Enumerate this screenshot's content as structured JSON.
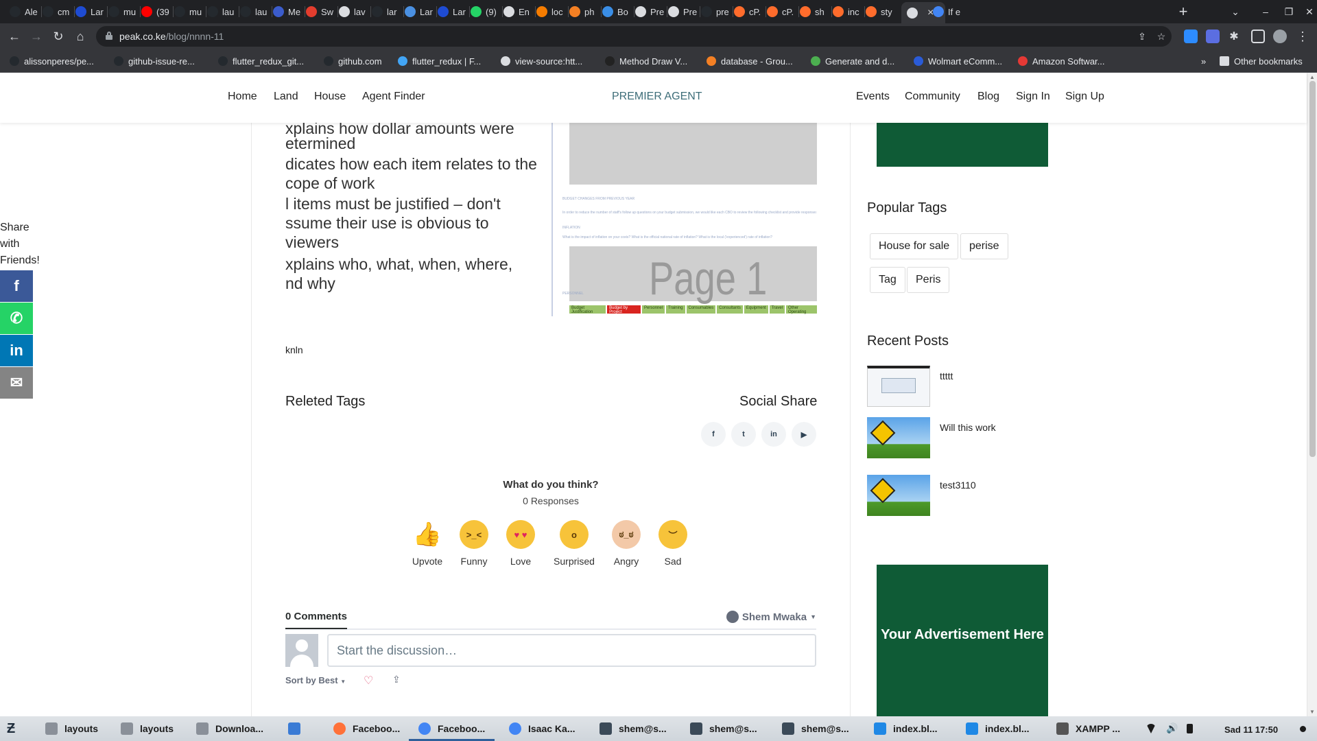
{
  "browser": {
    "tabs": [
      {
        "label": "Ale",
        "icon": "github-icon",
        "color": "#24292e"
      },
      {
        "label": "cm",
        "icon": "github-icon",
        "color": "#24292e"
      },
      {
        "label": "Lar",
        "icon": "tc-icon",
        "color": "#1e4bd2"
      },
      {
        "label": "mu",
        "icon": "github-icon",
        "color": "#24292e"
      },
      {
        "label": "(39",
        "icon": "youtube-icon",
        "color": "#ff0000"
      },
      {
        "label": "mu",
        "icon": "github-icon",
        "color": "#24292e"
      },
      {
        "label": "lau",
        "icon": "github-icon",
        "color": "#24292e"
      },
      {
        "label": "lau",
        "icon": "github-icon",
        "color": "#24292e"
      },
      {
        "label": "Me",
        "icon": "m-icon",
        "color": "#3b5ccc"
      },
      {
        "label": "Sw",
        "icon": "os-icon",
        "color": "#e33d2e"
      },
      {
        "label": "lav",
        "icon": "globe-icon",
        "color": "#dadce0"
      },
      {
        "label": "lar",
        "icon": "github-icon",
        "color": "#24292e"
      },
      {
        "label": "Lar",
        "icon": "arrow-icon",
        "color": "#4a90e2"
      },
      {
        "label": "Lar",
        "icon": "tc-icon",
        "color": "#1e4bd2"
      },
      {
        "label": "(9)",
        "icon": "whatsapp-icon",
        "color": "#25d366"
      },
      {
        "label": "En",
        "icon": "lines-icon",
        "color": "#dadce0"
      },
      {
        "label": "loc",
        "icon": "xampp-icon",
        "color": "#f57c00"
      },
      {
        "label": "ph",
        "icon": "stack-icon",
        "color": "#f48024"
      },
      {
        "label": "Bo",
        "icon": "bd-icon",
        "color": "#3a8ee6"
      },
      {
        "label": "Pre",
        "icon": "globe-icon",
        "color": "#dadce0"
      },
      {
        "label": "Pre",
        "icon": "globe-icon",
        "color": "#dadce0"
      },
      {
        "label": "pre",
        "icon": "github-icon",
        "color": "#24292e"
      },
      {
        "label": "cP.",
        "icon": "cpanel-icon",
        "color": "#ff6c2c"
      },
      {
        "label": "cP.",
        "icon": "cpanel-icon",
        "color": "#ff6c2c"
      },
      {
        "label": "sh",
        "icon": "cpanel-icon",
        "color": "#ff6c2c"
      },
      {
        "label": "inc",
        "icon": "cpanel-icon",
        "color": "#ff6c2c"
      },
      {
        "label": "sty",
        "icon": "cpanel-icon",
        "color": "#ff6c2c"
      },
      {
        "label": "",
        "icon": "globe-icon",
        "color": "#dadce0",
        "active": true
      },
      {
        "label": "If e",
        "icon": "google-icon",
        "color": "#4285f4"
      }
    ],
    "url_host": "peak.co.ke",
    "url_path": "/blog/nnnn-11",
    "bookmarks": [
      {
        "label": "alissonperes/pe...",
        "color": "#24292e"
      },
      {
        "label": "github-issue-re...",
        "color": "#24292e"
      },
      {
        "label": "flutter_redux_git...",
        "color": "#24292e"
      },
      {
        "label": "github.com",
        "color": "#24292e"
      },
      {
        "label": "flutter_redux | F...",
        "color": "#42a5f5"
      },
      {
        "label": "view-source:htt...",
        "color": "#dadce0"
      },
      {
        "label": "Method Draw V...",
        "color": "#222"
      },
      {
        "label": "database - Grou...",
        "color": "#f48024"
      },
      {
        "label": "Generate and d...",
        "color": "#4caf50"
      },
      {
        "label": "Wolmart eComm...",
        "color": "#2a5bd7"
      },
      {
        "label": "Amazon Softwar...",
        "color": "#e53935"
      }
    ],
    "bookmarks_overflow": "»",
    "other_bookmarks": "Other bookmarks"
  },
  "site": {
    "nav_left": [
      "Home",
      "Land",
      "House",
      "Agent Finder"
    ],
    "brand": "PREMIER AGENT",
    "nav_right": [
      "Events",
      "Community",
      "Blog",
      "Sign In",
      "Sign Up"
    ]
  },
  "slide": {
    "lines": [
      "xplains how dollar amounts were",
      "etermined",
      "dicates how each item relates to the",
      "cope of work",
      "l items must be justified – don't",
      "ssume their use is obvious to",
      "viewers",
      "xplains who, what, when, where,",
      "nd why"
    ],
    "doc_lines": [
      "BUDGET CHANGES FROM PREVIOUS YEAR",
      "In order to reduce the number of staff's follow up questions on your budget submission, we would like each CBO to review the following checklist and provide responses when you submit your",
      "INFLATION",
      "What is the impact of inflation on your costs? What is the official national rate of inflation? What is the local ('experienced') rate of inflation?",
      "PERSONNEL"
    ],
    "page_label": "Page 1",
    "doc_tabs": [
      "Budget Justification",
      "Budget by Project",
      "Personnel",
      "Training",
      "Consumables",
      "Consultants",
      "Equipment",
      "Travel",
      "Other Operating"
    ]
  },
  "post": {
    "body": "knln",
    "related_tags_title": "Releted Tags",
    "social_share_title": "Social Share",
    "social_share": [
      {
        "icon": "facebook-icon",
        "glyph": "f"
      },
      {
        "icon": "twitter-icon",
        "glyph": "t"
      },
      {
        "icon": "linkedin-icon",
        "glyph": "in"
      },
      {
        "icon": "youtube-icon",
        "glyph": "▶"
      }
    ]
  },
  "reactions": {
    "question": "What do you think?",
    "responses": "0 Responses",
    "items": [
      {
        "label": "Upvote",
        "icon": "thumbs-up-icon"
      },
      {
        "label": "Funny",
        "icon": "funny-face-icon"
      },
      {
        "label": "Love",
        "icon": "heart-eyes-icon"
      },
      {
        "label": "Surprised",
        "icon": "surprised-face-icon"
      },
      {
        "label": "Angry",
        "icon": "angry-face-icon"
      },
      {
        "label": "Sad",
        "icon": "sad-face-icon"
      }
    ]
  },
  "comments": {
    "count_label": "0 Comments",
    "user": "Shem Mwaka",
    "placeholder": "Start the discussion…",
    "sort": "Sort by Best"
  },
  "share_sidebar": {
    "label": "Share with Friends!",
    "buttons": [
      {
        "icon": "facebook-icon",
        "glyph": "f",
        "color": "#3b5998"
      },
      {
        "icon": "whatsapp-icon",
        "glyph": "✆",
        "color": "#25d366"
      },
      {
        "icon": "linkedin-icon",
        "glyph": "in",
        "color": "#0077b5"
      },
      {
        "icon": "email-icon",
        "glyph": "✉",
        "color": "#848484"
      }
    ]
  },
  "sidebar": {
    "popular_tags_title": "Popular Tags",
    "tags": [
      "House for sale",
      "perise",
      "Tag",
      "Peris"
    ],
    "recent_posts_title": "Recent Posts",
    "recent_posts": [
      {
        "title": "ttttt"
      },
      {
        "title": "Will this work"
      },
      {
        "title": "test3110"
      }
    ],
    "ad_text": "Your Advertisement Here",
    "ad_color": "#0f5b36"
  },
  "taskbar": {
    "items": [
      {
        "label": "layouts",
        "icon": "folder-icon"
      },
      {
        "label": "layouts",
        "icon": "folder-icon"
      },
      {
        "label": "Downloa...",
        "icon": "folder-icon"
      },
      {
        "label": "",
        "icon": "store-icon"
      },
      {
        "label": "Faceboo...",
        "icon": "firefox-icon"
      },
      {
        "label": "Faceboo...",
        "icon": "chrome-icon",
        "active": true
      },
      {
        "label": "Isaac Ka...",
        "icon": "chrome-icon"
      },
      {
        "label": "shem@s...",
        "icon": "terminal-icon"
      },
      {
        "label": "shem@s...",
        "icon": "terminal-icon"
      },
      {
        "label": "shem@s...",
        "icon": "terminal-icon"
      },
      {
        "label": "index.bl...",
        "icon": "vscode-icon"
      },
      {
        "label": "index.bl...",
        "icon": "vscode-icon"
      },
      {
        "label": "XAMPP ...",
        "icon": "xampp-icon"
      }
    ],
    "clock": "Sad 11  17:50"
  }
}
